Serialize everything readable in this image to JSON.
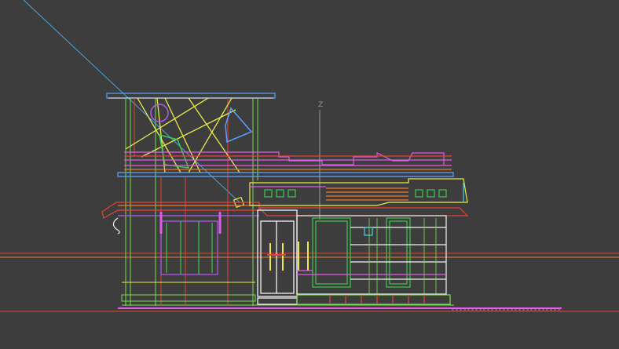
{
  "viewport": {
    "background": "#3d3d3d",
    "axis_label": "Z"
  },
  "colors": {
    "grid_line": "#9a9a9a",
    "red": "#e8413a",
    "orange": "#f07a2a",
    "yellow": "#e9e84c",
    "lime": "#77e04e",
    "green": "#3fc94f",
    "cyan": "#49d2e8",
    "blue": "#5aa0ff",
    "violet": "#b65af0",
    "magenta": "#e35ae8",
    "white": "#f2f2f2",
    "camera_line": "#4aa3d8"
  },
  "objects": [
    {
      "name": "camera-target-line"
    },
    {
      "name": "roof-top-slab"
    },
    {
      "name": "parapet-frame"
    },
    {
      "name": "main-roof-edge"
    },
    {
      "name": "left-window"
    },
    {
      "name": "entrance-door"
    },
    {
      "name": "right-glass-facade"
    },
    {
      "name": "balcony-canopy"
    },
    {
      "name": "ground-line"
    }
  ]
}
